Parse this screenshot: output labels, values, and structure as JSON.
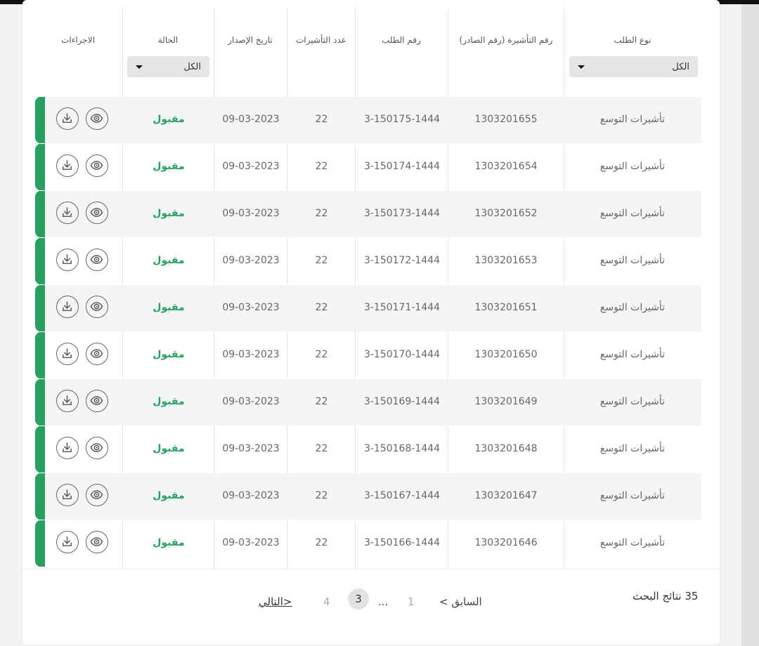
{
  "table": {
    "headers": {
      "request_type": "نوع الطلب",
      "visa_number": "رقم التأشيرة (رقم الصادر)",
      "request_number": "رقم الطلب",
      "visa_count": "عدد التأشيرات",
      "issue_date": "تاريخ الإصدار",
      "status": "الحالة",
      "actions": "الاجراءات"
    },
    "filters": {
      "request_type_value": "الكل",
      "status_value": "الكل"
    },
    "rows": [
      {
        "type": "تأشيرات التوسع",
        "visa": "1303201655",
        "request": "3-150175-1444",
        "count": "22",
        "date": "09-03-2023",
        "status": "مقبول"
      },
      {
        "type": "تأشيرات التوسع",
        "visa": "1303201654",
        "request": "3-150174-1444",
        "count": "22",
        "date": "09-03-2023",
        "status": "مقبول"
      },
      {
        "type": "تأشيرات التوسع",
        "visa": "1303201652",
        "request": "3-150173-1444",
        "count": "22",
        "date": "09-03-2023",
        "status": "مقبول"
      },
      {
        "type": "تأشيرات التوسع",
        "visa": "1303201653",
        "request": "3-150172-1444",
        "count": "22",
        "date": "09-03-2023",
        "status": "مقبول"
      },
      {
        "type": "تأشيرات التوسع",
        "visa": "1303201651",
        "request": "3-150171-1444",
        "count": "22",
        "date": "09-03-2023",
        "status": "مقبول"
      },
      {
        "type": "تأشيرات التوسع",
        "visa": "1303201650",
        "request": "3-150170-1444",
        "count": "22",
        "date": "09-03-2023",
        "status": "مقبول"
      },
      {
        "type": "تأشيرات التوسع",
        "visa": "1303201649",
        "request": "3-150169-1444",
        "count": "22",
        "date": "09-03-2023",
        "status": "مقبول"
      },
      {
        "type": "تأشيرات التوسع",
        "visa": "1303201648",
        "request": "3-150168-1444",
        "count": "22",
        "date": "09-03-2023",
        "status": "مقبول"
      },
      {
        "type": "تأشيرات التوسع",
        "visa": "1303201647",
        "request": "3-150167-1444",
        "count": "22",
        "date": "09-03-2023",
        "status": "مقبول"
      },
      {
        "type": "تأشيرات التوسع",
        "visa": "1303201646",
        "request": "3-150166-1444",
        "count": "22",
        "date": "09-03-2023",
        "status": "مقبول"
      }
    ]
  },
  "footer": {
    "results": "35 نتائج البحث",
    "prev": "< السابق",
    "page_1": "1",
    "ellipsis": "...",
    "page_current": "3",
    "page_4": "4",
    "next": "التالي>"
  },
  "colors": {
    "accent": "#28a060",
    "row_shade": "#f3f5f7"
  },
  "icons": {
    "view": "eye-icon",
    "download": "download-icon"
  }
}
